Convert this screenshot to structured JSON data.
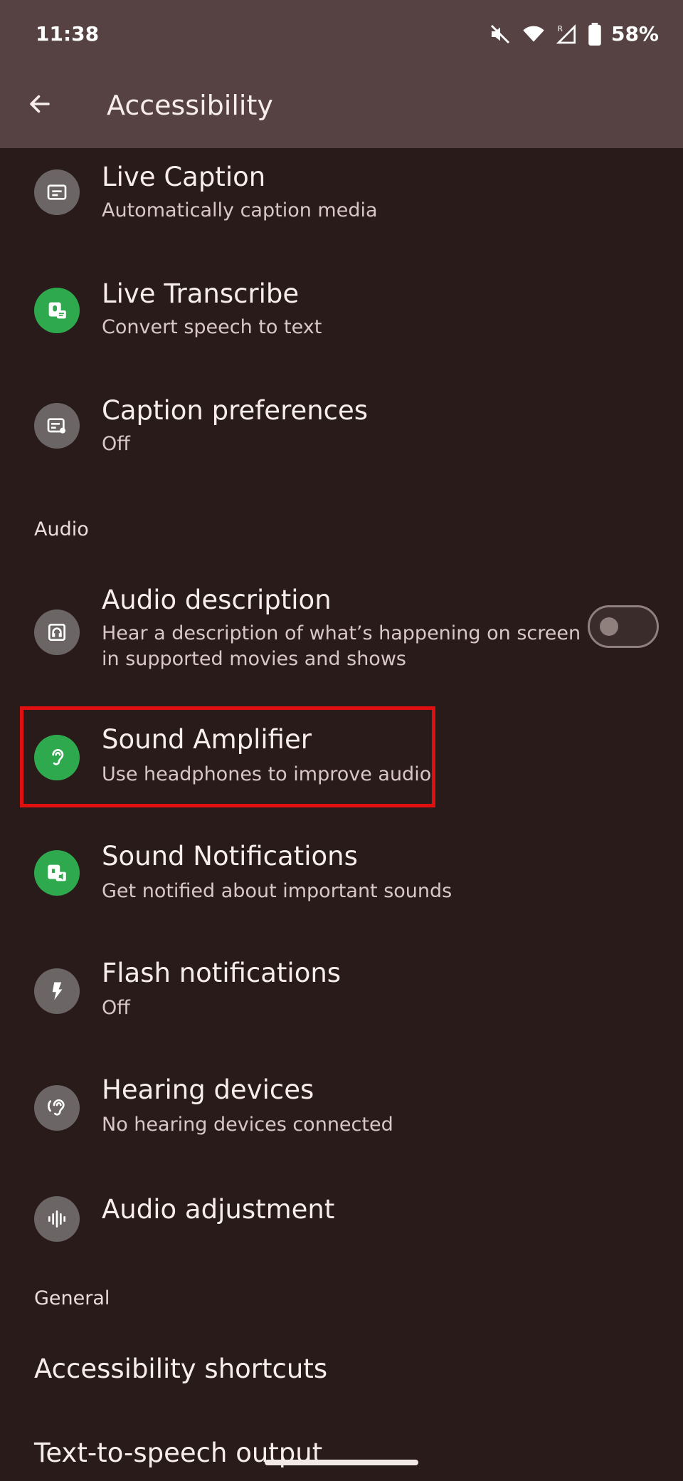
{
  "status_bar": {
    "time": "11:38",
    "battery_percent": "58%",
    "icons": [
      "mute-icon",
      "wifi-icon",
      "signal-icon",
      "battery-icon"
    ]
  },
  "app_bar": {
    "title": "Accessibility",
    "back_icon": "arrow-back-icon"
  },
  "items": [
    {
      "title": "Live Caption",
      "subtitle": "Automatically caption media",
      "icon": "caption-icon"
    },
    {
      "title": "Live Transcribe",
      "subtitle": "Convert speech to text",
      "icon": "live-transcribe-icon"
    },
    {
      "title": "Caption preferences",
      "subtitle": "Off",
      "icon": "caption-settings-icon"
    }
  ],
  "audio_section": {
    "label": "Audio",
    "items": [
      {
        "title": "Audio description",
        "subtitle_line1": "Hear a description of what’s happening on screen",
        "subtitle_line2": "in supported movies and shows",
        "icon": "audio-description-icon",
        "toggle_on": false
      },
      {
        "title": "Sound Amplifier",
        "subtitle": "Use headphones to improve audio",
        "icon": "ear-icon"
      },
      {
        "title": "Sound Notifications",
        "subtitle": "Get notified about important sounds",
        "icon": "sound-notifications-icon"
      },
      {
        "title": "Flash notifications",
        "subtitle": "Off",
        "icon": "flash-icon"
      },
      {
        "title": "Hearing devices",
        "subtitle": "No hearing devices connected",
        "icon": "hearing-icon"
      },
      {
        "title": "Audio adjustment",
        "icon": "waveform-icon"
      }
    ]
  },
  "general_section": {
    "label": "General",
    "items": [
      {
        "title": "Accessibility shortcuts"
      },
      {
        "title": "Text-to-speech output"
      }
    ]
  },
  "colors": {
    "background": "#2a1b1b",
    "app_bar": "#564242",
    "green_icon": "#2fa94e",
    "gray_icon": "#6b6565",
    "highlight": "#e01010"
  }
}
